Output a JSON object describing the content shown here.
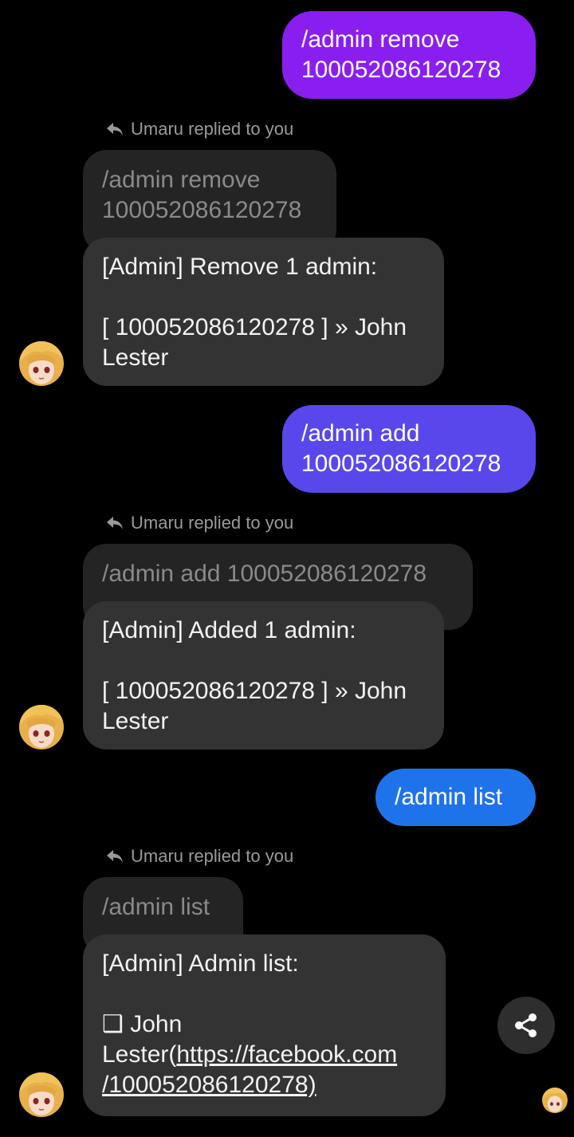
{
  "colors": {
    "outgoing_1": "#8a1ef0",
    "outgoing_2": "#5848ec",
    "outgoing_3": "#1f73ea",
    "incoming_bubble": "#333333",
    "quoted_bubble": "#242424",
    "background": "#000000"
  },
  "messages": [
    {
      "outgoing": "/admin remove\n100052086120278",
      "replied_label": "Umaru replied to you",
      "quoted": "/admin remove\n100052086120278",
      "reply": "[Admin] Remove 1 admin:\n\n[ 100052086120278 ] » John\nLester"
    },
    {
      "outgoing": "/admin add\n100052086120278",
      "replied_label": "Umaru replied to you",
      "quoted": "/admin add 100052086120278",
      "reply": "[Admin] Added 1 admin:\n\n[ 100052086120278 ] » John\nLester"
    },
    {
      "outgoing": "/admin list",
      "replied_label": "Umaru replied to you",
      "quoted": "/admin list",
      "reply_text": "[Admin] Admin list:\n\n❑ John\nLester(",
      "reply_link": "https://facebook.com\n/100052086120278)"
    }
  ],
  "icons": {
    "reply": "reply-arrow-icon",
    "share": "share-icon",
    "avatar": "umaru-avatar"
  }
}
